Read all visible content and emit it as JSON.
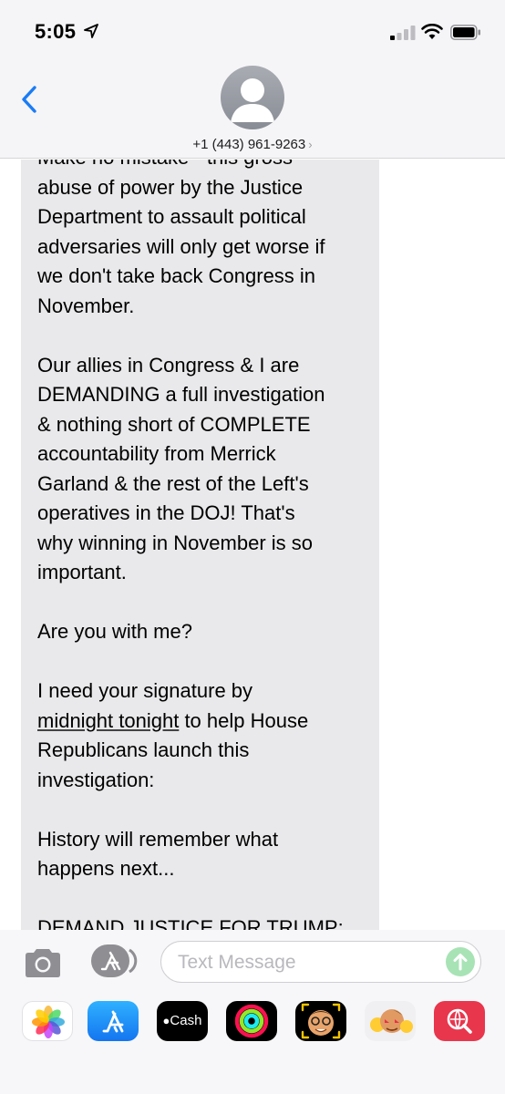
{
  "status_bar": {
    "time": "5:05"
  },
  "header": {
    "contact": "+1 (443) 961-9263",
    "chevron": "›"
  },
  "message": {
    "lines": [
      "Make no mistake - this gross",
      "abuse of power by the Justice",
      "Department to assault political",
      "adversaries will only get worse if",
      "we don't take back Congress in",
      "November.",
      "",
      "Our allies in Congress & I are",
      "DEMANDING a full investigation",
      "& nothing short of COMPLETE",
      "accountability from Merrick",
      "Garland & the rest of the Left's",
      "operatives in the DOJ! That's",
      "why winning in November is so",
      "important.",
      "",
      "Are you with me?",
      "",
      "I need your signature by",
      "midnight tonight",
      " to help House",
      "Republicans launch this",
      "investigation:",
      "",
      "History will remember what",
      "happens next...",
      "",
      "DEMAND JUSTICE FOR TRUMP:"
    ]
  },
  "compose": {
    "placeholder": "Text Message"
  },
  "app_drawer": {
    "apps": [
      {
        "name": "Photos",
        "icon": "photos-icon"
      },
      {
        "name": "App Store",
        "icon": "app-store-icon"
      },
      {
        "name": "Cash",
        "label": "Cash",
        "icon": "apple-cash-icon"
      },
      {
        "name": "Activity",
        "icon": "activity-rings-icon"
      },
      {
        "name": "Memoji",
        "icon": "memoji-icon"
      },
      {
        "name": "Memoji Stickers",
        "icon": "memoji-stickers-icon"
      },
      {
        "name": "Web Search",
        "icon": "web-search-icon"
      }
    ]
  },
  "colors": {
    "accent": "#1a7cf5",
    "bubble": "#e9e9eb",
    "send_disabled": "#a8e3b5",
    "placeholder": "#b8b8bd"
  }
}
